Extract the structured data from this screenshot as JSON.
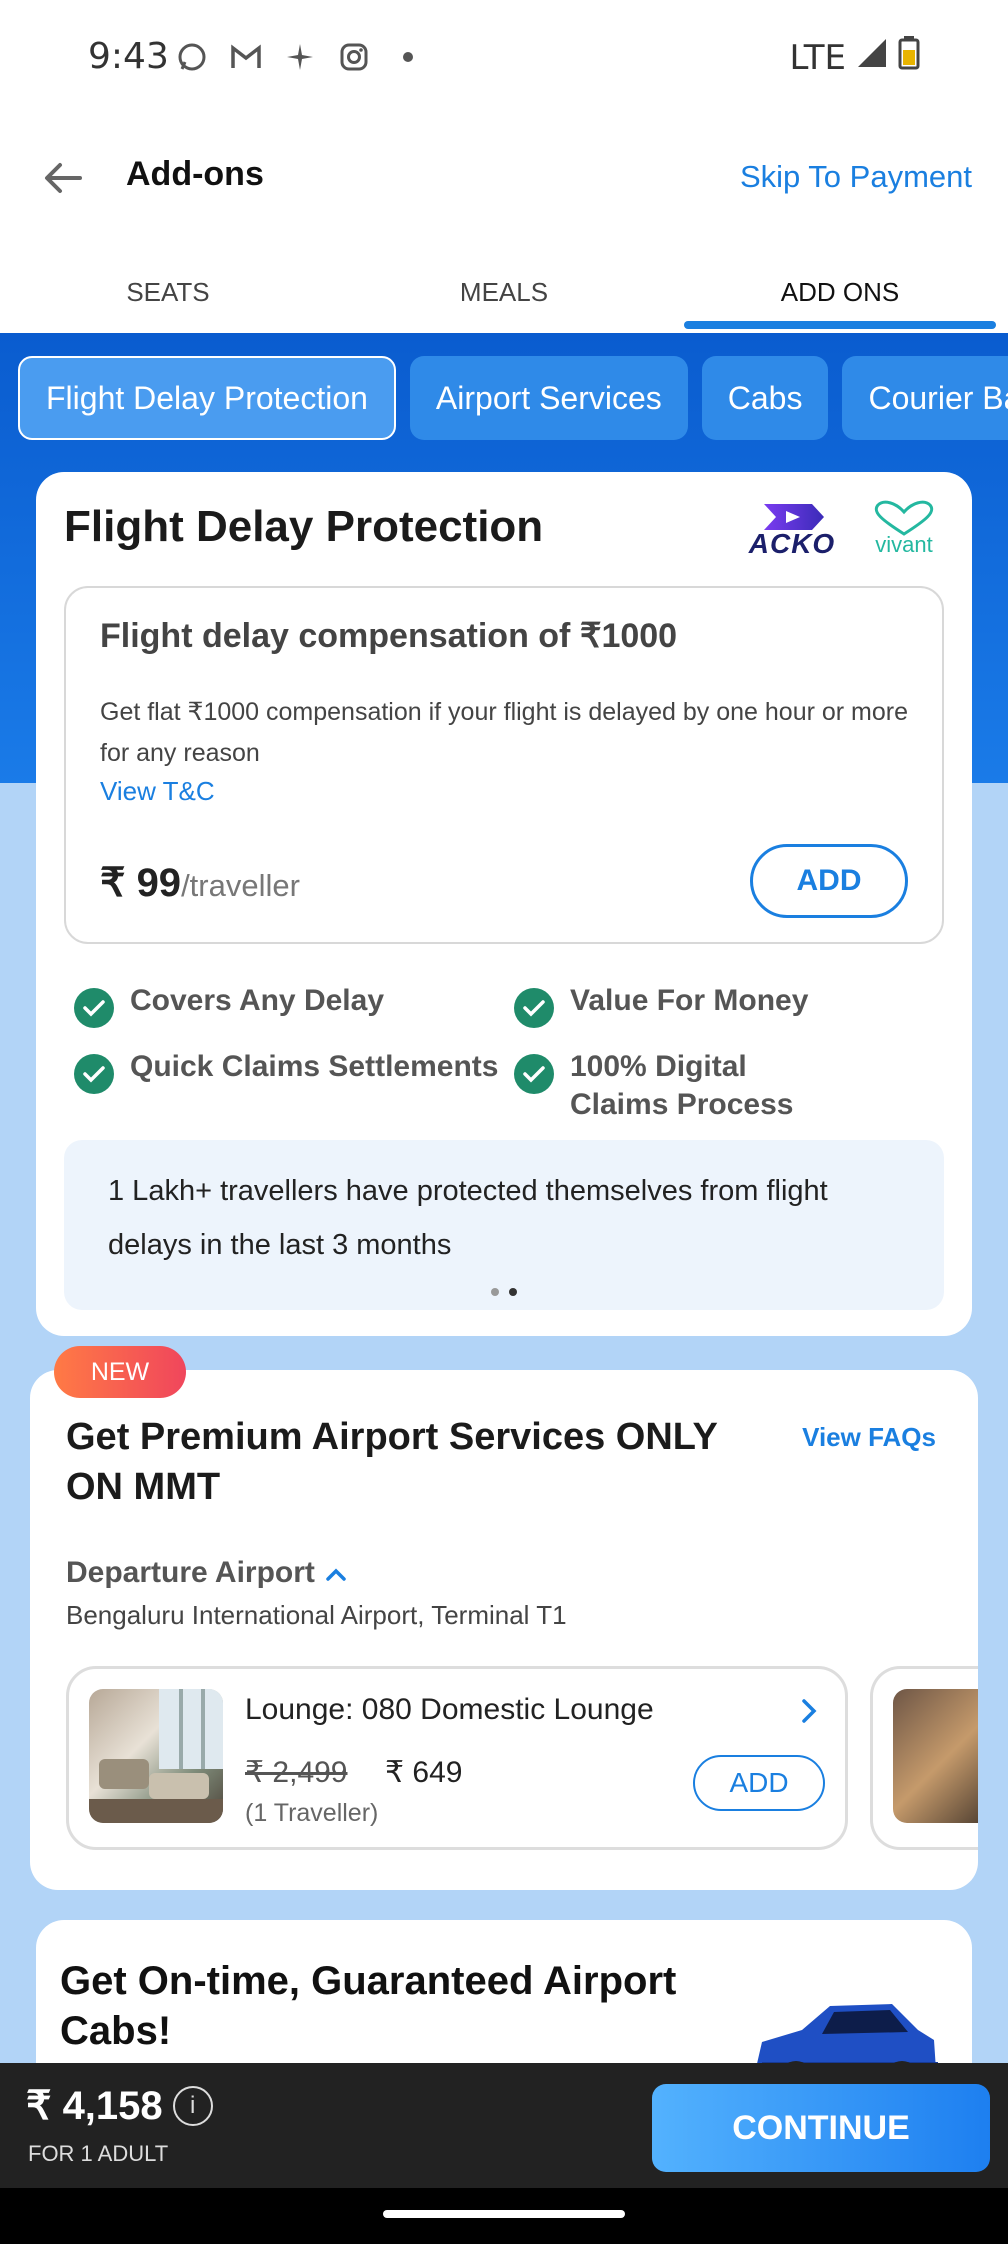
{
  "status_bar": {
    "time": "9:43",
    "network": "LTE"
  },
  "header": {
    "title": "Add-ons",
    "skip_label": "Skip To Payment"
  },
  "tabs": [
    {
      "label": "SEATS"
    },
    {
      "label": "MEALS"
    },
    {
      "label": "ADD ONS"
    }
  ],
  "chips": [
    {
      "label": "Flight Delay Protection"
    },
    {
      "label": "Airport Services"
    },
    {
      "label": "Cabs"
    },
    {
      "label": "Courier Ba"
    }
  ],
  "delay_card": {
    "title": "Flight Delay Protection",
    "logos": {
      "acko": "ACKO",
      "vivant": "vivant"
    },
    "offer": {
      "title": "Flight delay compensation of ₹1000",
      "description": "Get flat ₹1000 compensation if your flight is delayed by one hour or more for any reason",
      "tc_label": "View T&C",
      "price": "₹ 99",
      "per": "/traveller",
      "add_label": "ADD"
    },
    "features": [
      "Covers Any Delay",
      "Value For Money",
      "Quick Claims Settlements",
      "100% Digital Claims Process"
    ],
    "promo_text": "1 Lakh+ travellers have protected themselves from flight delays in the last 3 months"
  },
  "airport_card": {
    "badge": "NEW",
    "title": "Get Premium Airport Services ONLY ON MMT",
    "faq_label": "View FAQs",
    "departure_label": "Departure Airport",
    "departure_airport": "Bengaluru International Airport, Terminal T1",
    "lounge": {
      "title": "Lounge: 080 Domestic Lounge",
      "old_price": "₹ 2,499",
      "new_price": "₹ 649",
      "travellers": "(1 Traveller)",
      "add_label": "ADD"
    }
  },
  "cabs_card": {
    "title": "Get On-time, Guaranteed Airport Cabs!"
  },
  "bottom_bar": {
    "total": "₹ 4,158",
    "for_label": "FOR 1 ADULT",
    "continue_label": "CONTINUE"
  },
  "colors": {
    "accent": "#1a7fe0",
    "band": "#0a5ccf",
    "check": "#1f8b6a"
  }
}
